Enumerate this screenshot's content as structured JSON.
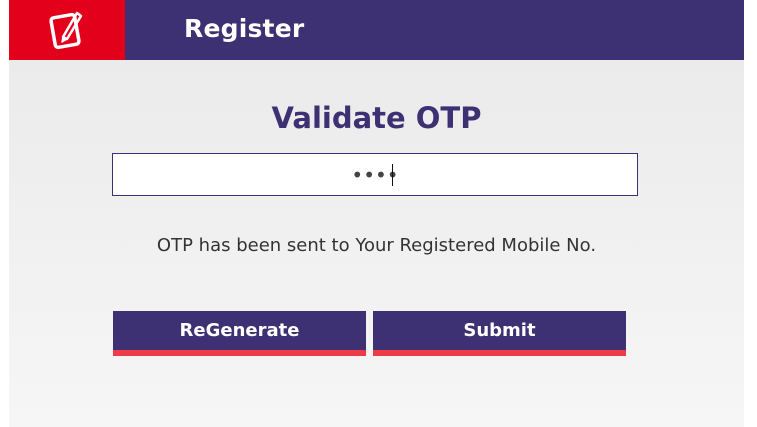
{
  "header": {
    "title": "Register",
    "icon": "edit-note-icon",
    "colors": {
      "bar": "#3d3173",
      "icon_bg": "#e3001b"
    }
  },
  "form": {
    "title": "Validate OTP",
    "otp_value": "••••",
    "message": "OTP has been sent to Your Registered Mobile No."
  },
  "buttons": {
    "regenerate_label": "ReGenerate",
    "submit_label": "Submit",
    "accent_color": "#ee3b48"
  }
}
